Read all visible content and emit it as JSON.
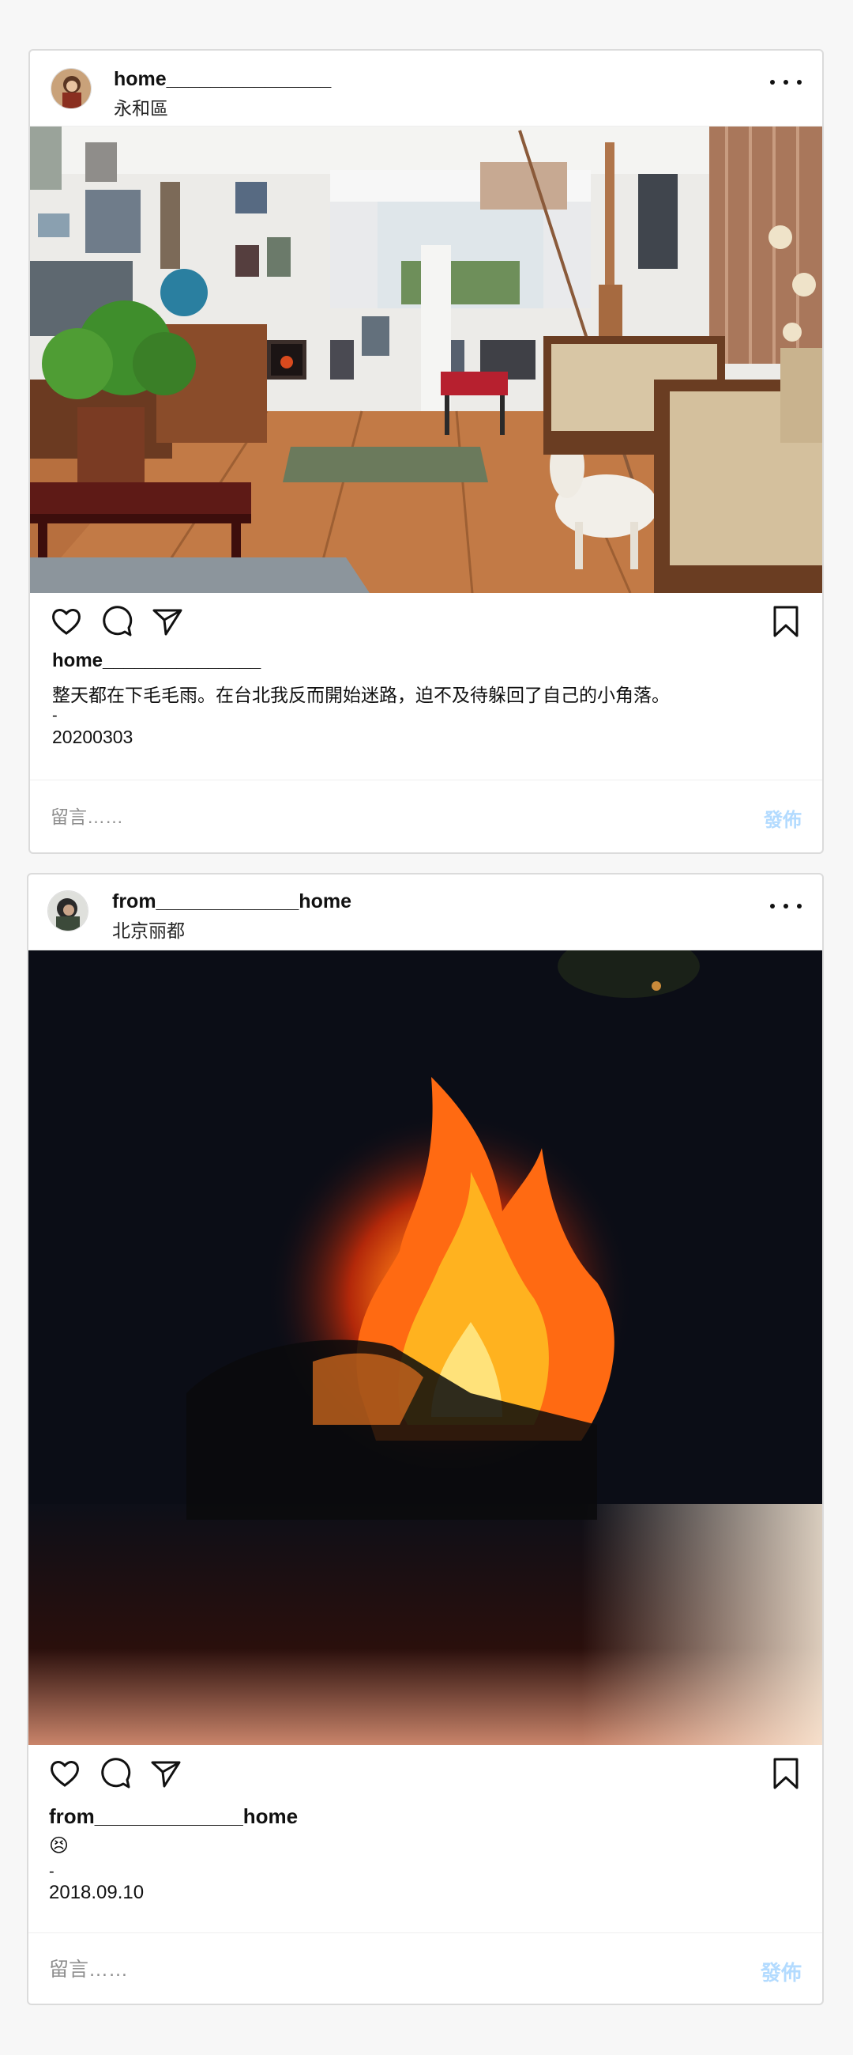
{
  "posts": [
    {
      "username": "home_______________",
      "location": "永和區",
      "caption_user": "home_______________",
      "caption_text": "整天都在下毛毛雨。在台北我反而開始迷路，迫不及待躲回了自己的小角落。",
      "caption_dash": "-",
      "caption_date": "20200303",
      "comment_placeholder": "留言……",
      "post_label": "發佈"
    },
    {
      "username": "from_____________home",
      "location": "北京丽都",
      "caption_user": "from_____________home",
      "caption_text": "😣",
      "caption_dash": "-",
      "caption_date": "2018.09.10",
      "comment_placeholder": "留言……",
      "post_label": "發佈"
    }
  ],
  "icons": [
    "heart-icon",
    "comment-icon",
    "share-icon",
    "bookmark-icon",
    "more-icon"
  ],
  "colors": {
    "background": "#f7f7f7",
    "card": "#ffffff",
    "border": "#dbdbdb",
    "post_button": "#b3dbff"
  }
}
